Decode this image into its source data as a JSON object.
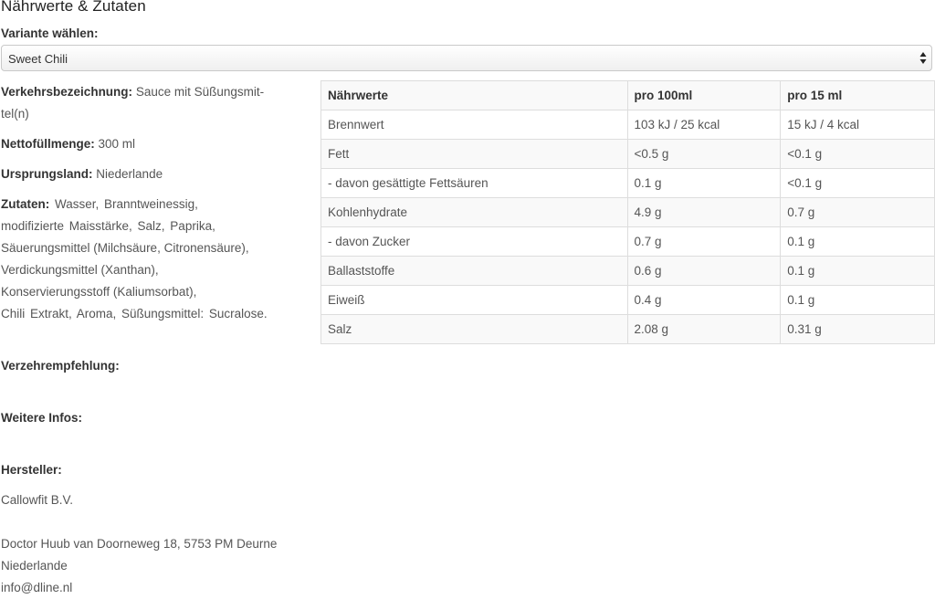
{
  "page": {
    "title": "Nährwerte & Zutaten"
  },
  "variant": {
    "label": "Variante wählen:",
    "selected": "Sweet Chili"
  },
  "product": {
    "designation_label": "Verkehrsbezeichnung:",
    "designation_line1": "Sauce mit Süßungsmit-",
    "designation_line2": "tel(n)",
    "net_label": "Nettofüllmenge:",
    "net_value": "300 ml",
    "origin_label": "Ursprungsland:",
    "origin_value": "Niederlande",
    "ingredients_label": "Zutaten:",
    "ingredients_lines": [
      "Wasser,  Branntweinessig,",
      "modifizierte Maisstärke,  Salz,  Paprika,",
      "Säuerungsmittel (Milchsäure, Citronensäure),",
      "Verdickungsmittel (Xanthan),",
      "Konservierungsstoff (Kaliumsorbat),",
      "Chili Extrakt,  Aroma,  Süßungsmittel: Sucralose."
    ],
    "recommendation_label": "Verzehrempfehlung:",
    "more_info_label": "Weitere Infos:",
    "manufacturer_label": "Hersteller:",
    "manufacturer_name": "Callowfit B.V.",
    "address_line1": "Doctor Huub van Doorneweg 18, 5753 PM Deurne",
    "address_line2": "Niederlande",
    "email": "info@dline.nl"
  },
  "nutrition": {
    "headers": [
      "Nährwerte",
      "pro 100ml",
      "pro 15 ml"
    ],
    "rows": [
      [
        "Brennwert",
        "103 kJ / 25 kcal",
        "15 kJ / 4 kcal"
      ],
      [
        "Fett",
        "<0.5 g",
        "<0.1 g"
      ],
      [
        "- davon gesättigte Fettsäuren",
        "0.1 g",
        "<0.1 g"
      ],
      [
        "Kohlenhydrate",
        "4.9 g",
        "0.7 g"
      ],
      [
        "- davon Zucker",
        "0.7 g",
        "0.1 g"
      ],
      [
        "Ballaststoffe",
        "0.6 g",
        "0.1 g"
      ],
      [
        "Eiweiß",
        "0.4 g",
        "0.1 g"
      ],
      [
        "Salz",
        "2.08 g",
        "0.31 g"
      ]
    ]
  },
  "icons": {
    "select_arrows": "updown-arrows-icon"
  }
}
